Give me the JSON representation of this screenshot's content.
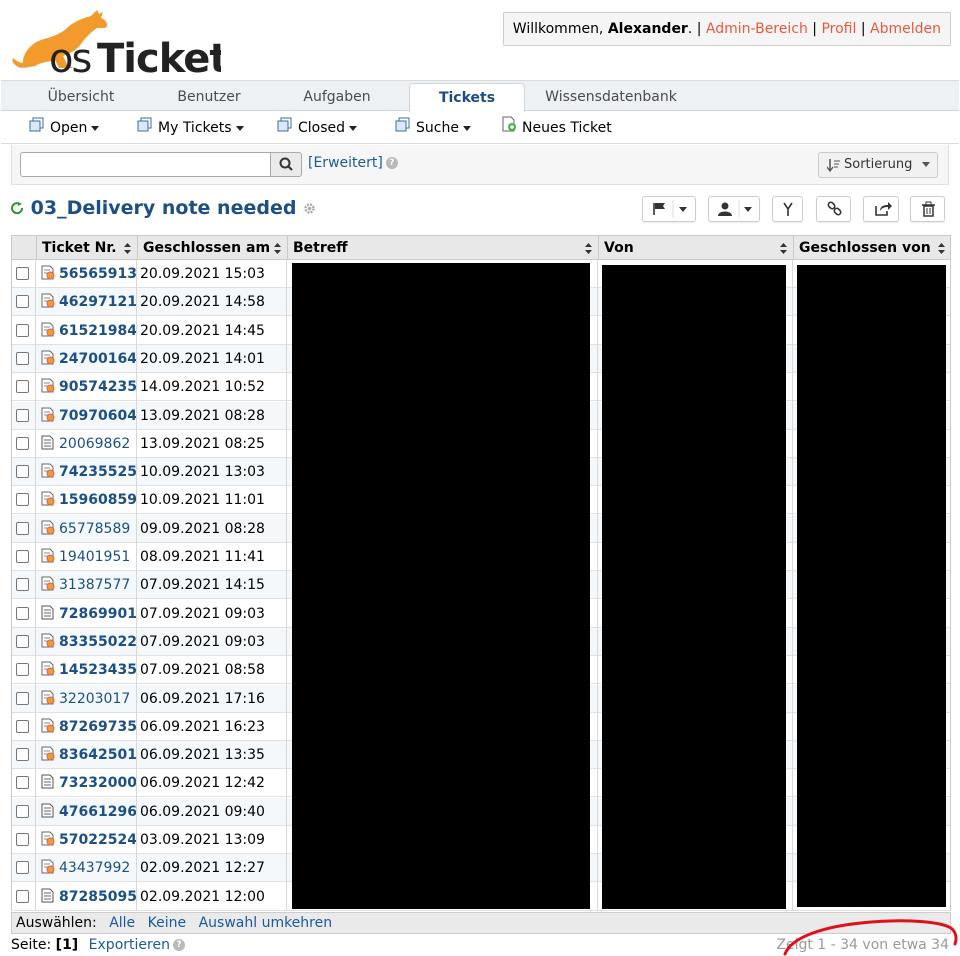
{
  "header": {
    "welcome_prefix": "Willkommen,",
    "user": "Alexander",
    "after_user": ". |",
    "admin_link": "Admin-Bereich",
    "sep1": "|",
    "profile_link": "Profil",
    "sep2": "|",
    "logout_link": "Abmelden"
  },
  "tabs": [
    {
      "label": "Übersicht"
    },
    {
      "label": "Benutzer"
    },
    {
      "label": "Aufgaben"
    },
    {
      "label": "Tickets",
      "active": true
    },
    {
      "label": "Wissensdatenbank"
    }
  ],
  "subnav": {
    "open": "Open",
    "my_tickets": "My Tickets",
    "closed": "Closed",
    "search": "Suche",
    "new_ticket": "Neues Ticket"
  },
  "search": {
    "value": "",
    "advanced": "[Erweitert]",
    "sort_label": "Sortierung"
  },
  "queue": {
    "title": "03_Delivery note needed"
  },
  "table": {
    "columns": [
      "Ticket Nr.",
      "Geschlossen am",
      "Betreff",
      "Von",
      "Geschlossen von"
    ],
    "rows": [
      {
        "num": "56565913",
        "date": "20.09.2021 15:03",
        "bold": true,
        "icon": "web"
      },
      {
        "num": "46297121",
        "date": "20.09.2021 14:58",
        "bold": true,
        "icon": "web"
      },
      {
        "num": "61521984",
        "date": "20.09.2021 14:45",
        "bold": true,
        "icon": "web"
      },
      {
        "num": "24700164",
        "date": "20.09.2021 14:01",
        "bold": true,
        "icon": "web"
      },
      {
        "num": "90574235",
        "date": "14.09.2021 10:52",
        "bold": true,
        "icon": "web"
      },
      {
        "num": "70970604",
        "date": "13.09.2021 08:28",
        "bold": true,
        "icon": "web"
      },
      {
        "num": "20069862",
        "date": "13.09.2021 08:25",
        "bold": false,
        "icon": "doc"
      },
      {
        "num": "74235525",
        "date": "10.09.2021 13:03",
        "bold": true,
        "icon": "web"
      },
      {
        "num": "15960859",
        "date": "10.09.2021 11:01",
        "bold": true,
        "icon": "web"
      },
      {
        "num": "65778589",
        "date": "09.09.2021 08:28",
        "bold": false,
        "icon": "web"
      },
      {
        "num": "19401951",
        "date": "08.09.2021 11:41",
        "bold": false,
        "icon": "web"
      },
      {
        "num": "31387577",
        "date": "07.09.2021 14:15",
        "bold": false,
        "icon": "web"
      },
      {
        "num": "72869901",
        "date": "07.09.2021 09:03",
        "bold": true,
        "icon": "doc"
      },
      {
        "num": "83355022",
        "date": "07.09.2021 09:03",
        "bold": true,
        "icon": "web"
      },
      {
        "num": "14523435",
        "date": "07.09.2021 08:58",
        "bold": true,
        "icon": "web"
      },
      {
        "num": "32203017",
        "date": "06.09.2021 17:16",
        "bold": false,
        "icon": "web"
      },
      {
        "num": "87269735",
        "date": "06.09.2021 16:23",
        "bold": true,
        "icon": "web"
      },
      {
        "num": "83642501",
        "date": "06.09.2021 13:35",
        "bold": true,
        "icon": "web"
      },
      {
        "num": "73232000",
        "date": "06.09.2021 12:42",
        "bold": true,
        "icon": "doc"
      },
      {
        "num": "47661296",
        "date": "06.09.2021 09:40",
        "bold": true,
        "icon": "doc"
      },
      {
        "num": "57022524",
        "date": "03.09.2021 13:09",
        "bold": true,
        "icon": "web"
      },
      {
        "num": "43437992",
        "date": "02.09.2021 12:27",
        "bold": false,
        "icon": "web"
      },
      {
        "num": "87285095",
        "date": "02.09.2021 12:00",
        "bold": true,
        "icon": "doc"
      }
    ]
  },
  "footer": {
    "select_label": "Auswählen:",
    "all": "Alle",
    "none": "Keine",
    "invert": "Auswahl umkehren",
    "page_label": "Seite:",
    "page": "[1]",
    "export": "Exportieren",
    "showing": "Zeigt 1 - 34 von etwa 34"
  },
  "colors": {
    "accent_link": "#e55a3c",
    "ticket_link": "#1c4f86",
    "logo_orange": "#f39a2c"
  }
}
